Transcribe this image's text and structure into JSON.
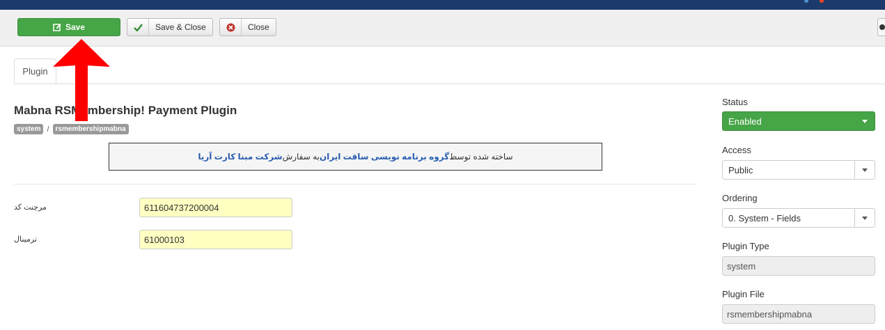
{
  "toolbar": {
    "save_label": "Save",
    "save_close_label": "Save & Close",
    "close_label": "Close"
  },
  "tabs": [
    {
      "label": "Plugin"
    }
  ],
  "plugin": {
    "title": "Mabna RSMembership! Payment Plugin",
    "crumbs": [
      "system",
      "rsmembershipmabna"
    ],
    "notice": {
      "part1": "ساخته شده توسط ",
      "link1": "گروه برنامه نویسی ساقت ایران",
      "part2": "به سفارش ",
      "link2": "شرکت مبنا کارت آریا"
    }
  },
  "fields": [
    {
      "label": "مرچنت کد",
      "value": "611604737200004"
    },
    {
      "label": "ترمینال",
      "value": "61000103"
    }
  ],
  "sidebar": {
    "status": {
      "label": "Status",
      "value": "Enabled"
    },
    "access": {
      "label": "Access",
      "value": "Public"
    },
    "ordering": {
      "label": "Ordering",
      "value": "0. System - Fields"
    },
    "plugin_type": {
      "label": "Plugin Type",
      "value": "system"
    },
    "plugin_file": {
      "label": "Plugin File",
      "value": "rsmembershipmabna"
    }
  },
  "colors": {
    "topbar": "#1c3a6b",
    "save_green": "#46a546",
    "highlight_input": "#ffffc2",
    "annotation_arrow": "#ff0000"
  }
}
